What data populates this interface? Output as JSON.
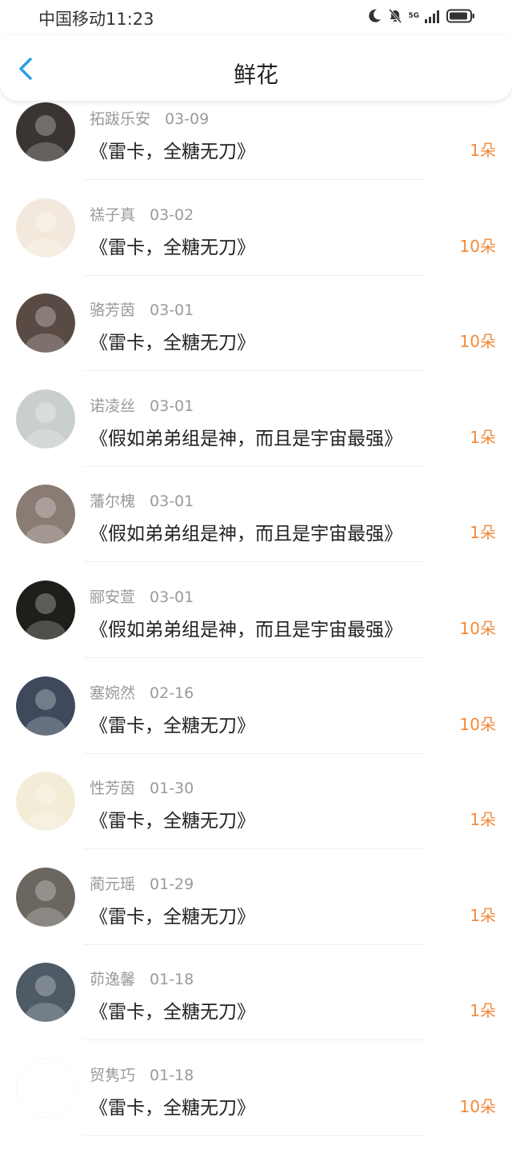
{
  "status_bar": {
    "carrier_time": "中国移动11:23",
    "network": "5G"
  },
  "header": {
    "title": "鲜花"
  },
  "colors": {
    "accent_count": "#f08a3c",
    "back_arrow": "#2aa0e8"
  },
  "entries": [
    {
      "name": "拓跋乐安",
      "date": "03-09",
      "work": "《雷卡，全糖无刀》",
      "count": "1朵",
      "avatar_color": "#3a3532"
    },
    {
      "name": "禚子真",
      "date": "03-02",
      "work": "《雷卡，全糖无刀》",
      "count": "10朵",
      "avatar_color": "#f2e9dc"
    },
    {
      "name": "骆芳茵",
      "date": "03-01",
      "work": "《雷卡，全糖无刀》",
      "count": "10朵",
      "avatar_color": "#5a4a44"
    },
    {
      "name": "诺凌丝",
      "date": "03-01",
      "work": "《假如弟弟组是神，而且是宇宙最强》",
      "count": "1朵",
      "avatar_color": "#c9cfcc"
    },
    {
      "name": "藩尔槐",
      "date": "03-01",
      "work": "《假如弟弟组是神，而且是宇宙最强》",
      "count": "1朵",
      "avatar_color": "#8a7b73"
    },
    {
      "name": "郦安萱",
      "date": "03-01",
      "work": "《假如弟弟组是神，而且是宇宙最强》",
      "count": "10朵",
      "avatar_color": "#1d1f1a"
    },
    {
      "name": "塞婉然",
      "date": "02-16",
      "work": "《雷卡，全糖无刀》",
      "count": "10朵",
      "avatar_color": "#3e4a5c"
    },
    {
      "name": "性芳茵",
      "date": "01-30",
      "work": "《雷卡，全糖无刀》",
      "count": "1朵",
      "avatar_color": "#f3ecd6"
    },
    {
      "name": "蔺元瑶",
      "date": "01-29",
      "work": "《雷卡，全糖无刀》",
      "count": "1朵",
      "avatar_color": "#6b6660"
    },
    {
      "name": "茆逸馨",
      "date": "01-18",
      "work": "《雷卡，全糖无刀》",
      "count": "1朵",
      "avatar_color": "#4e5a66"
    },
    {
      "name": "贸隽巧",
      "date": "01-18",
      "work": "《雷卡，全糖无刀》",
      "count": "10朵",
      "avatar_color": "#ffffff"
    }
  ]
}
